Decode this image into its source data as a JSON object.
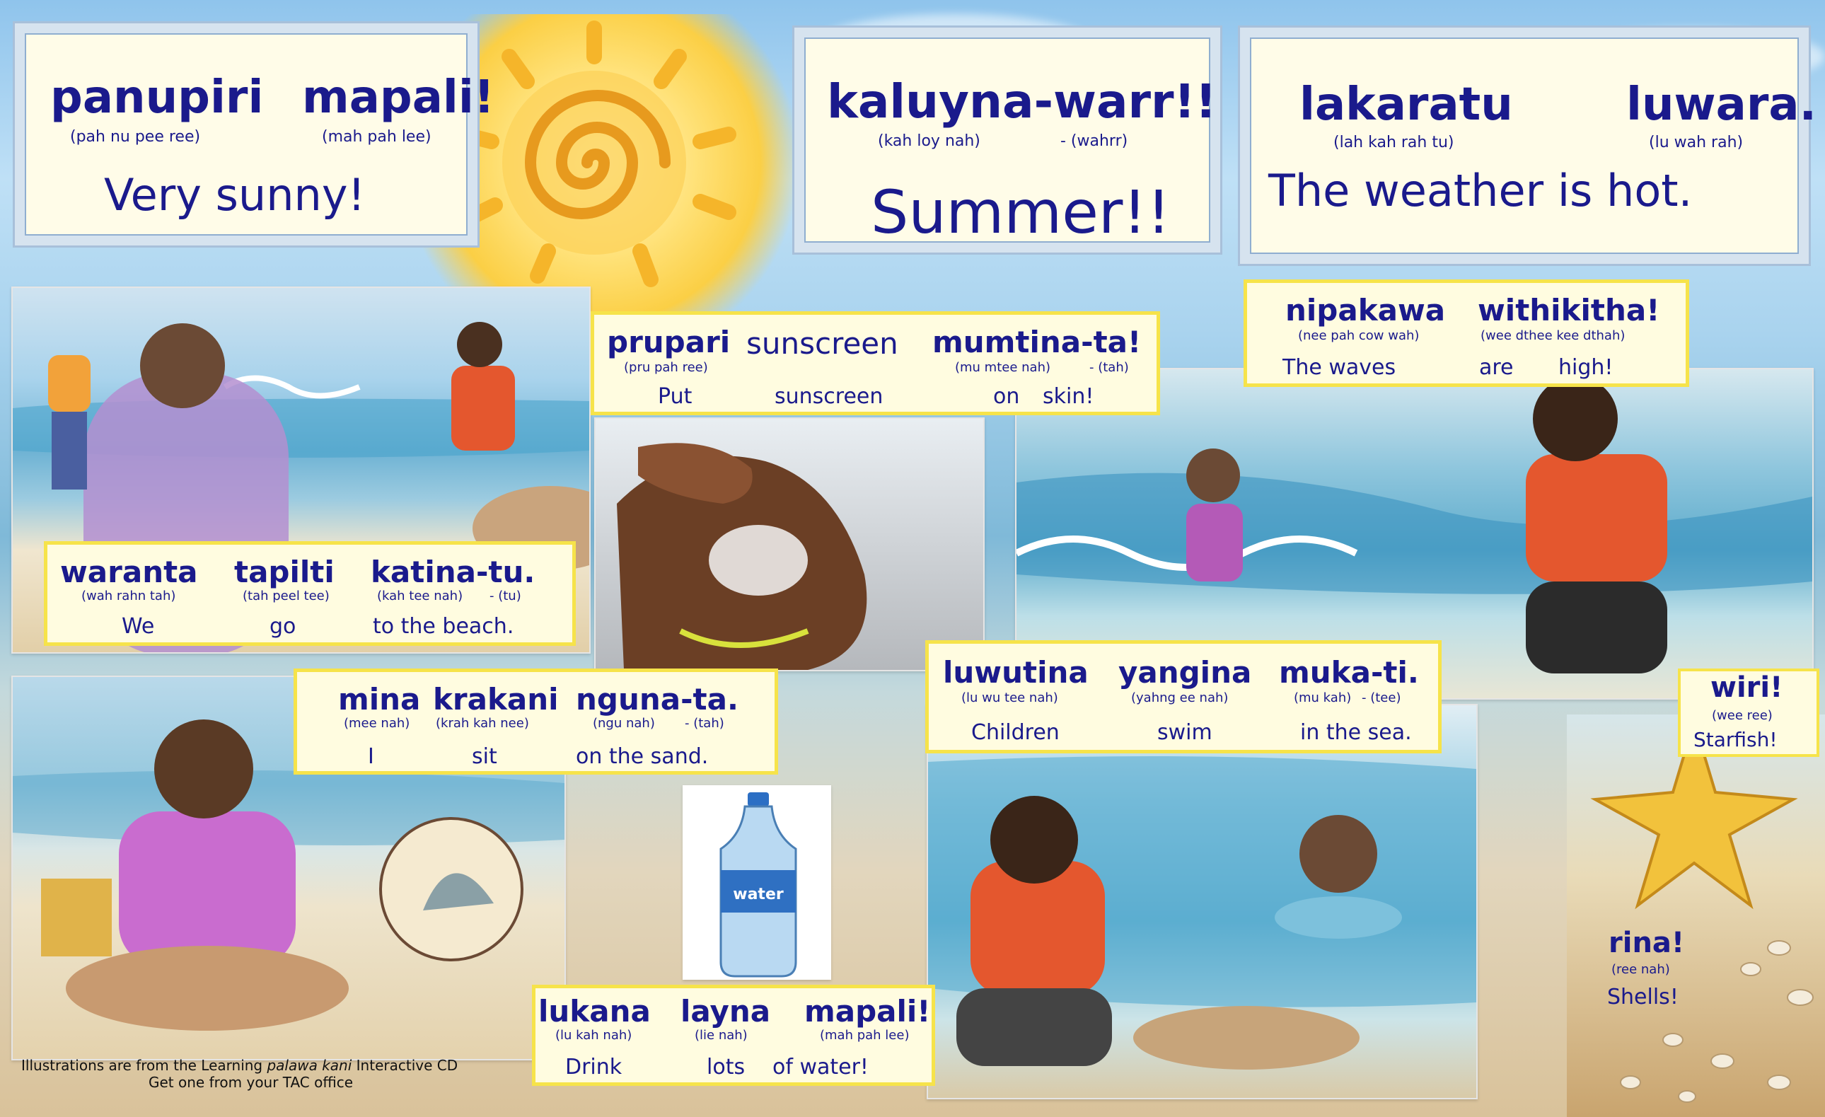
{
  "title_panels": [
    {
      "words": [
        {
          "text": "panupiri",
          "pron": "(pah nu pee ree)"
        },
        {
          "text": "mapali!",
          "pron": "(mah pah lee)"
        }
      ],
      "english": "Very  sunny!"
    },
    {
      "words": [
        {
          "text": "kaluyna-warr!!",
          "pron": "(kah loy nah)"
        },
        {
          "text": "",
          "pron": "-    (wahrr)"
        }
      ],
      "english": "Summer!!"
    },
    {
      "words": [
        {
          "text": "lakaratu",
          "pron": "(lah kah rah tu)"
        },
        {
          "text": "luwara.",
          "pron": "(lu wah rah)"
        }
      ],
      "english": "The  weather  is  hot."
    }
  ],
  "captions": {
    "sunscreen": {
      "words": [
        "prupari",
        "sunscreen",
        "mumtina-ta!"
      ],
      "prons": [
        "(pru pah ree)",
        "(mu  mtee nah)",
        "-  (tah)"
      ],
      "english": [
        "Put",
        "sunscreen",
        "on",
        "skin!"
      ]
    },
    "waves": {
      "words": [
        "nipakawa",
        "withikitha!"
      ],
      "prons": [
        "(nee pah cow wah)",
        "(wee dthee kee dthah)"
      ],
      "english": [
        "The  waves",
        "are",
        "high!"
      ]
    },
    "beach": {
      "words": [
        "waranta",
        "tapilti",
        "katina-tu."
      ],
      "prons": [
        "(wah rahn tah)",
        "(tah peel tee)",
        "(kah tee nah)",
        "-  (tu)"
      ],
      "english": [
        "We",
        "go",
        "to  the  beach."
      ]
    },
    "sand": {
      "words": [
        "mina",
        "krakani",
        "nguna-ta."
      ],
      "prons": [
        "(mee nah)",
        "(krah kah nee)",
        "(ngu nah)",
        "-  (tah)"
      ],
      "english": [
        "I",
        "sit",
        "on  the  sand."
      ]
    },
    "swim": {
      "words": [
        "luwutina",
        "yangina",
        "muka-ti."
      ],
      "prons": [
        "(lu wu tee nah)",
        "(yahng ee nah)",
        "(mu kah)",
        "-  (tee)"
      ],
      "english": [
        "Children",
        "swim",
        "in  the  sea."
      ]
    },
    "water": {
      "words": [
        "lukana",
        "layna",
        "mapali!"
      ],
      "prons": [
        "(lu kah nah)",
        "(lie nah)",
        "(mah pah lee)"
      ],
      "english": [
        "Drink",
        "lots",
        "of  water!"
      ]
    },
    "starfish": {
      "word": "wiri!",
      "pron": "(wee ree)",
      "english": "Starfish!"
    },
    "shells": {
      "word": "rina!",
      "pron": "(ree nah)",
      "english": "Shells!"
    }
  },
  "bottle_label": "water",
  "credit": {
    "line1_a": "Illustrations are from the Learning ",
    "line1_b": "palawa kani",
    "line1_c": " Interactive CD",
    "line2": "Get one from your TAC office"
  },
  "colors": {
    "text": "#1a1a8c",
    "caption_border": "#f6e34a",
    "caption_bg": "#fffce0"
  }
}
